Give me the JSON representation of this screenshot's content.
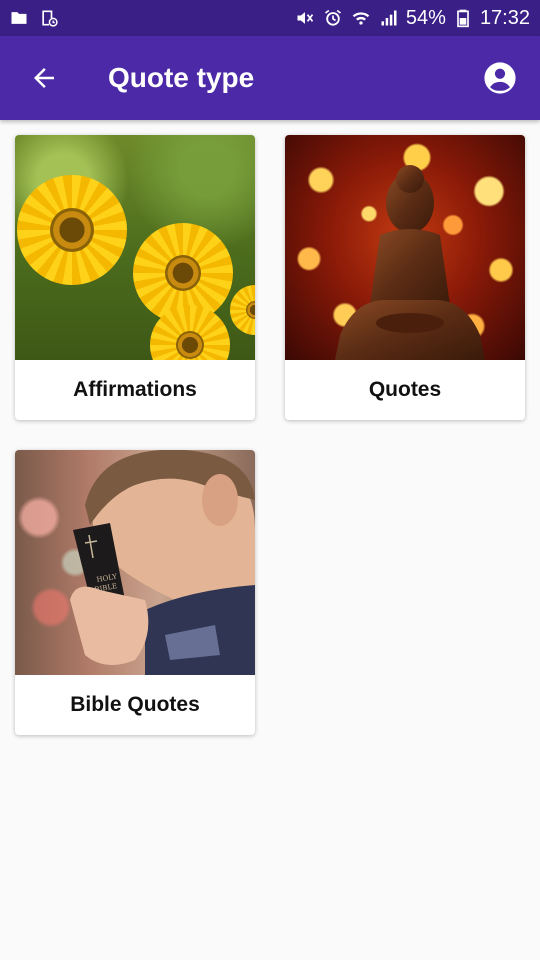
{
  "status_bar": {
    "battery": "54%",
    "time": "17:32",
    "left_icons": [
      "folder-icon",
      "screenshot-icon"
    ],
    "right_icons": [
      "mute-icon",
      "alarm-icon",
      "wifi-icon",
      "signal-icon",
      "battery-icon"
    ]
  },
  "app_bar": {
    "title": "Quote type",
    "background": "#4c2aa7",
    "status_background": "#3a1f87",
    "back_icon": "arrow-back-icon",
    "account_icon": "account-circle-icon"
  },
  "categories": [
    {
      "label": "Affirmations",
      "image": "sunflowers"
    },
    {
      "label": "Quotes",
      "image": "buddha-statue-bokeh"
    },
    {
      "label": "Bible Quotes",
      "image": "boy-praying-with-bible"
    }
  ]
}
